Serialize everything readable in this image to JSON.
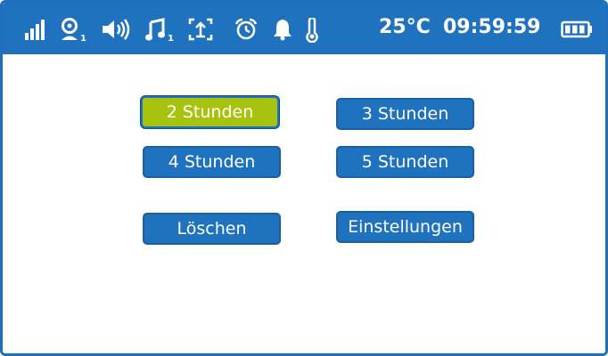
{
  "status_bar": {
    "temperature": "25°C",
    "time": "09:59:59",
    "camera_index": "1",
    "lullaby_index": "1",
    "icons": [
      "signal-strength-icon",
      "camera-icon",
      "volume-icon",
      "lullaby-icon",
      "zoom-icon",
      "alarm-clock-icon",
      "bell-icon",
      "thermometer-icon",
      "battery-icon"
    ]
  },
  "menu": {
    "items": [
      {
        "label": "2 Stunden",
        "selected": true
      },
      {
        "label": "3 Stunden",
        "selected": false
      },
      {
        "label": "4 Stunden",
        "selected": false
      },
      {
        "label": "5 Stunden",
        "selected": false
      },
      {
        "label": "Löschen",
        "selected": false
      },
      {
        "label": "Einstellungen",
        "selected": false
      }
    ]
  },
  "colors": {
    "accent_blue": "#1f72be",
    "selected_green": "#a8c30f",
    "background": "#ffffff"
  }
}
